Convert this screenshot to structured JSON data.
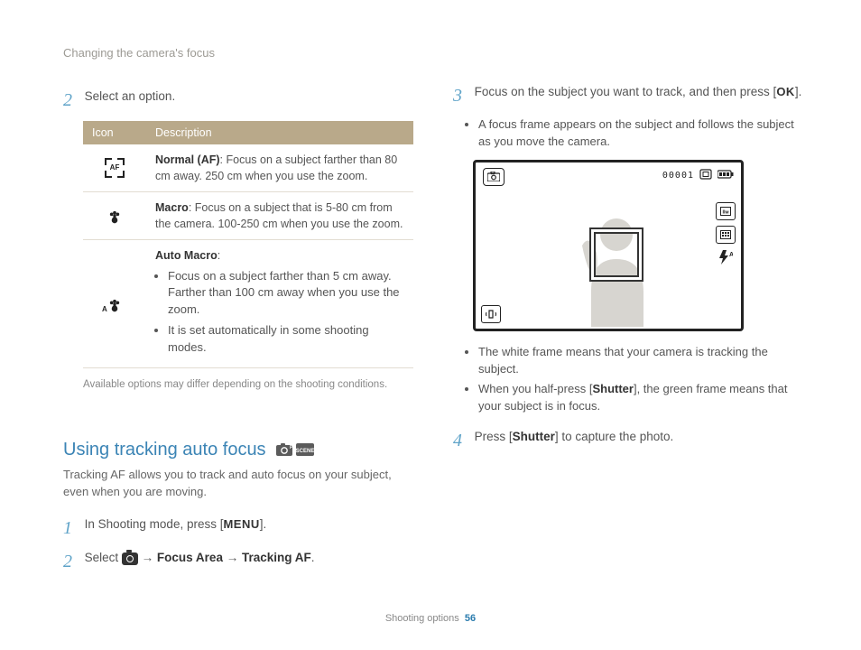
{
  "breadcrumb": "Changing the camera's focus",
  "left": {
    "step2num": "2",
    "step2text": "Select an option.",
    "table": {
      "h_icon": "Icon",
      "h_desc": "Description",
      "rows": [
        {
          "title": "Normal (AF)",
          "body": ": Focus on a subject farther than 80 cm away. 250 cm when you use the zoom."
        },
        {
          "title": "Macro",
          "body": ": Focus on a subject that is 5-80 cm from the camera. 100-250 cm when you use the zoom."
        },
        {
          "title": "Auto Macro",
          "body_colon": ":",
          "bullets": [
            "Focus on a subject farther than 5 cm away. Farther than 100 cm away when you use the zoom.",
            "It is set automatically in some shooting modes."
          ]
        }
      ]
    },
    "footnote": "Available options may differ depending on the shooting conditions.",
    "section_title": "Using tracking auto focus",
    "section_desc": "Tracking AF allows you to track and auto focus on your subject, even when you are moving.",
    "s1num": "1",
    "s1a": "In Shooting mode, press [",
    "s1menu": "MENU",
    "s1b": "].",
    "s2num": "2",
    "s2a": "Select ",
    "s2arrow1": " → ",
    "s2fa": "Focus Area",
    "s2arrow2": " → ",
    "s2taf": "Tracking AF",
    "s2end": "."
  },
  "right": {
    "s3num": "3",
    "s3a": "Focus on the subject you want to track, and then press [",
    "s3ok": "OK",
    "s3b": "].",
    "s3bullet": "A focus frame appears on the subject and follows the subject as you move the camera.",
    "lcd": {
      "counter": "00001"
    },
    "belowbul": [
      "The white frame means that your camera is tracking the subject."
    ],
    "belowbul2_a": "When you half-press [",
    "belowbul2_sh": "Shutter",
    "belowbul2_b": "], the green frame means that your subject is in focus.",
    "s4num": "4",
    "s4a": "Press [",
    "s4sh": "Shutter",
    "s4b": "] to capture the photo."
  },
  "footer": {
    "label": "Shooting options",
    "page": "56"
  }
}
